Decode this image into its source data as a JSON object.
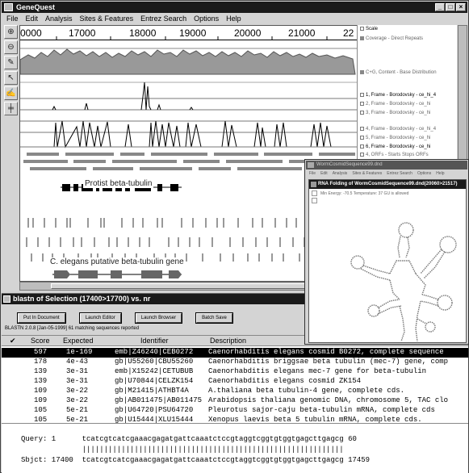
{
  "app": {
    "title": "GeneQuest"
  },
  "menu": [
    "File",
    "Edit",
    "Analysis",
    "Sites & Features",
    "Entrez Search",
    "Options",
    "Help"
  ],
  "ruler": {
    "ticks": [
      "0000",
      "17000",
      "18000",
      "19000",
      "20000",
      "21000",
      "22"
    ]
  },
  "features": {
    "protist": "Protist beta-tubulin",
    "elegans": "C. elegans putative beta-tubulin gene"
  },
  "tracks": [
    {
      "label": "Scale",
      "style": "open"
    },
    {
      "label": "Coverage - Direct Repeats",
      "style": "filled"
    },
    {
      "label": "C+G, Content - Base Distribution",
      "style": "filled"
    },
    {
      "label": "1, Frame - Borodovsky - ce_hi_4",
      "style": "open-dark"
    },
    {
      "label": "2, Frame - Borodovsky - ce_hi",
      "style": "open"
    },
    {
      "label": "3, Frame - Borodovsky - ce_hi",
      "style": "open"
    },
    {
      "label": "4, Frame - Borodovsky - ce_hi_4",
      "style": "open"
    },
    {
      "label": "5, Frame - Borodovsky - ce_hi",
      "style": "open"
    },
    {
      "label": "6, Frame - Borodovsky - ce_hi",
      "style": "open-dark"
    },
    {
      "label": "4, ORFs - Starts Stops ORFs",
      "style": "open"
    }
  ],
  "blast": {
    "title": "blastn of Selection (17400>17700) vs. nr",
    "buttons": [
      "Put In Document",
      "Launch Editor",
      "Launch Browser",
      "Batch Save"
    ],
    "version": "BLASTN 2.0.8 [Jan-05-1999]  61 matching sequences reported",
    "columns": {
      "check": "✔",
      "score": "Score",
      "expected": "Expected",
      "identifier": "Identifier",
      "description": "Description"
    },
    "rows": [
      {
        "score": "597",
        "expected": "1e-169",
        "identifier": "emb|Z46240|CEB0272",
        "description": "Caenorhabditis elegans cosmid B0272, complete sequence"
      },
      {
        "score": "178",
        "expected": "4e-43",
        "identifier": "gb|U55260|CBU55260",
        "description": "Caenorhabditis briggsae beta tubulin (mec-7) gene, comp"
      },
      {
        "score": "139",
        "expected": "3e-31",
        "identifier": "emb|X15242|CETUBUB",
        "description": "Caenorhabditis elegans mec-7 gene for beta-tubulin"
      },
      {
        "score": "139",
        "expected": "3e-31",
        "identifier": "gb|U70844|CELZK154",
        "description": "Caenorhabditis elegans cosmid ZK154"
      },
      {
        "score": "109",
        "expected": "3e-22",
        "identifier": "gb|M21415|ATHBT4A",
        "description": "A.thaliana beta tubulin-4 gene, complete cds."
      },
      {
        "score": "109",
        "expected": "3e-22",
        "identifier": "gb|AB011475|AB011475",
        "description": "Arabidopsis thaliana genomic DNA, chromosome 5, TAC clo"
      },
      {
        "score": "105",
        "expected": "5e-21",
        "identifier": "gb|U64720|PSU64720",
        "description": "Pleurotus sajor-caju beta-tubulin mRNA, complete cds"
      },
      {
        "score": "105",
        "expected": "5e-21",
        "identifier": "gb|U15444|XLU15444",
        "description": "Xenopus laevis beta 5 tubulin mRNA, complete cds."
      }
    ],
    "alignment": {
      "query": "Query: 1      tcatcgtcatcgaaacgagatgattcaaatctccgtaggtcggtgtggtgagcttgagcg 60",
      "bars": "              ||||||||||||||||||||||||||||||||||||||||||||||||||||||||||||",
      "sbjct": "Sbjct: 17400  tcatcgtcatcgaaacgagatgattcaaatctccgtaggtcggtgtggtgagcttgagcg 17459"
    }
  },
  "rna": {
    "window_title": "WormCosmidSequence99.dnd",
    "menu": [
      "File",
      "Edit",
      "Analysis",
      "Sites & Features",
      "Entrez Search",
      "Options",
      "Help"
    ],
    "inner_title": "RNA Folding of WormCosmidSequence99.dnd(20060>21517)",
    "info": "Min Energy: -70.5   Temperature: 37    GU is allowed"
  }
}
